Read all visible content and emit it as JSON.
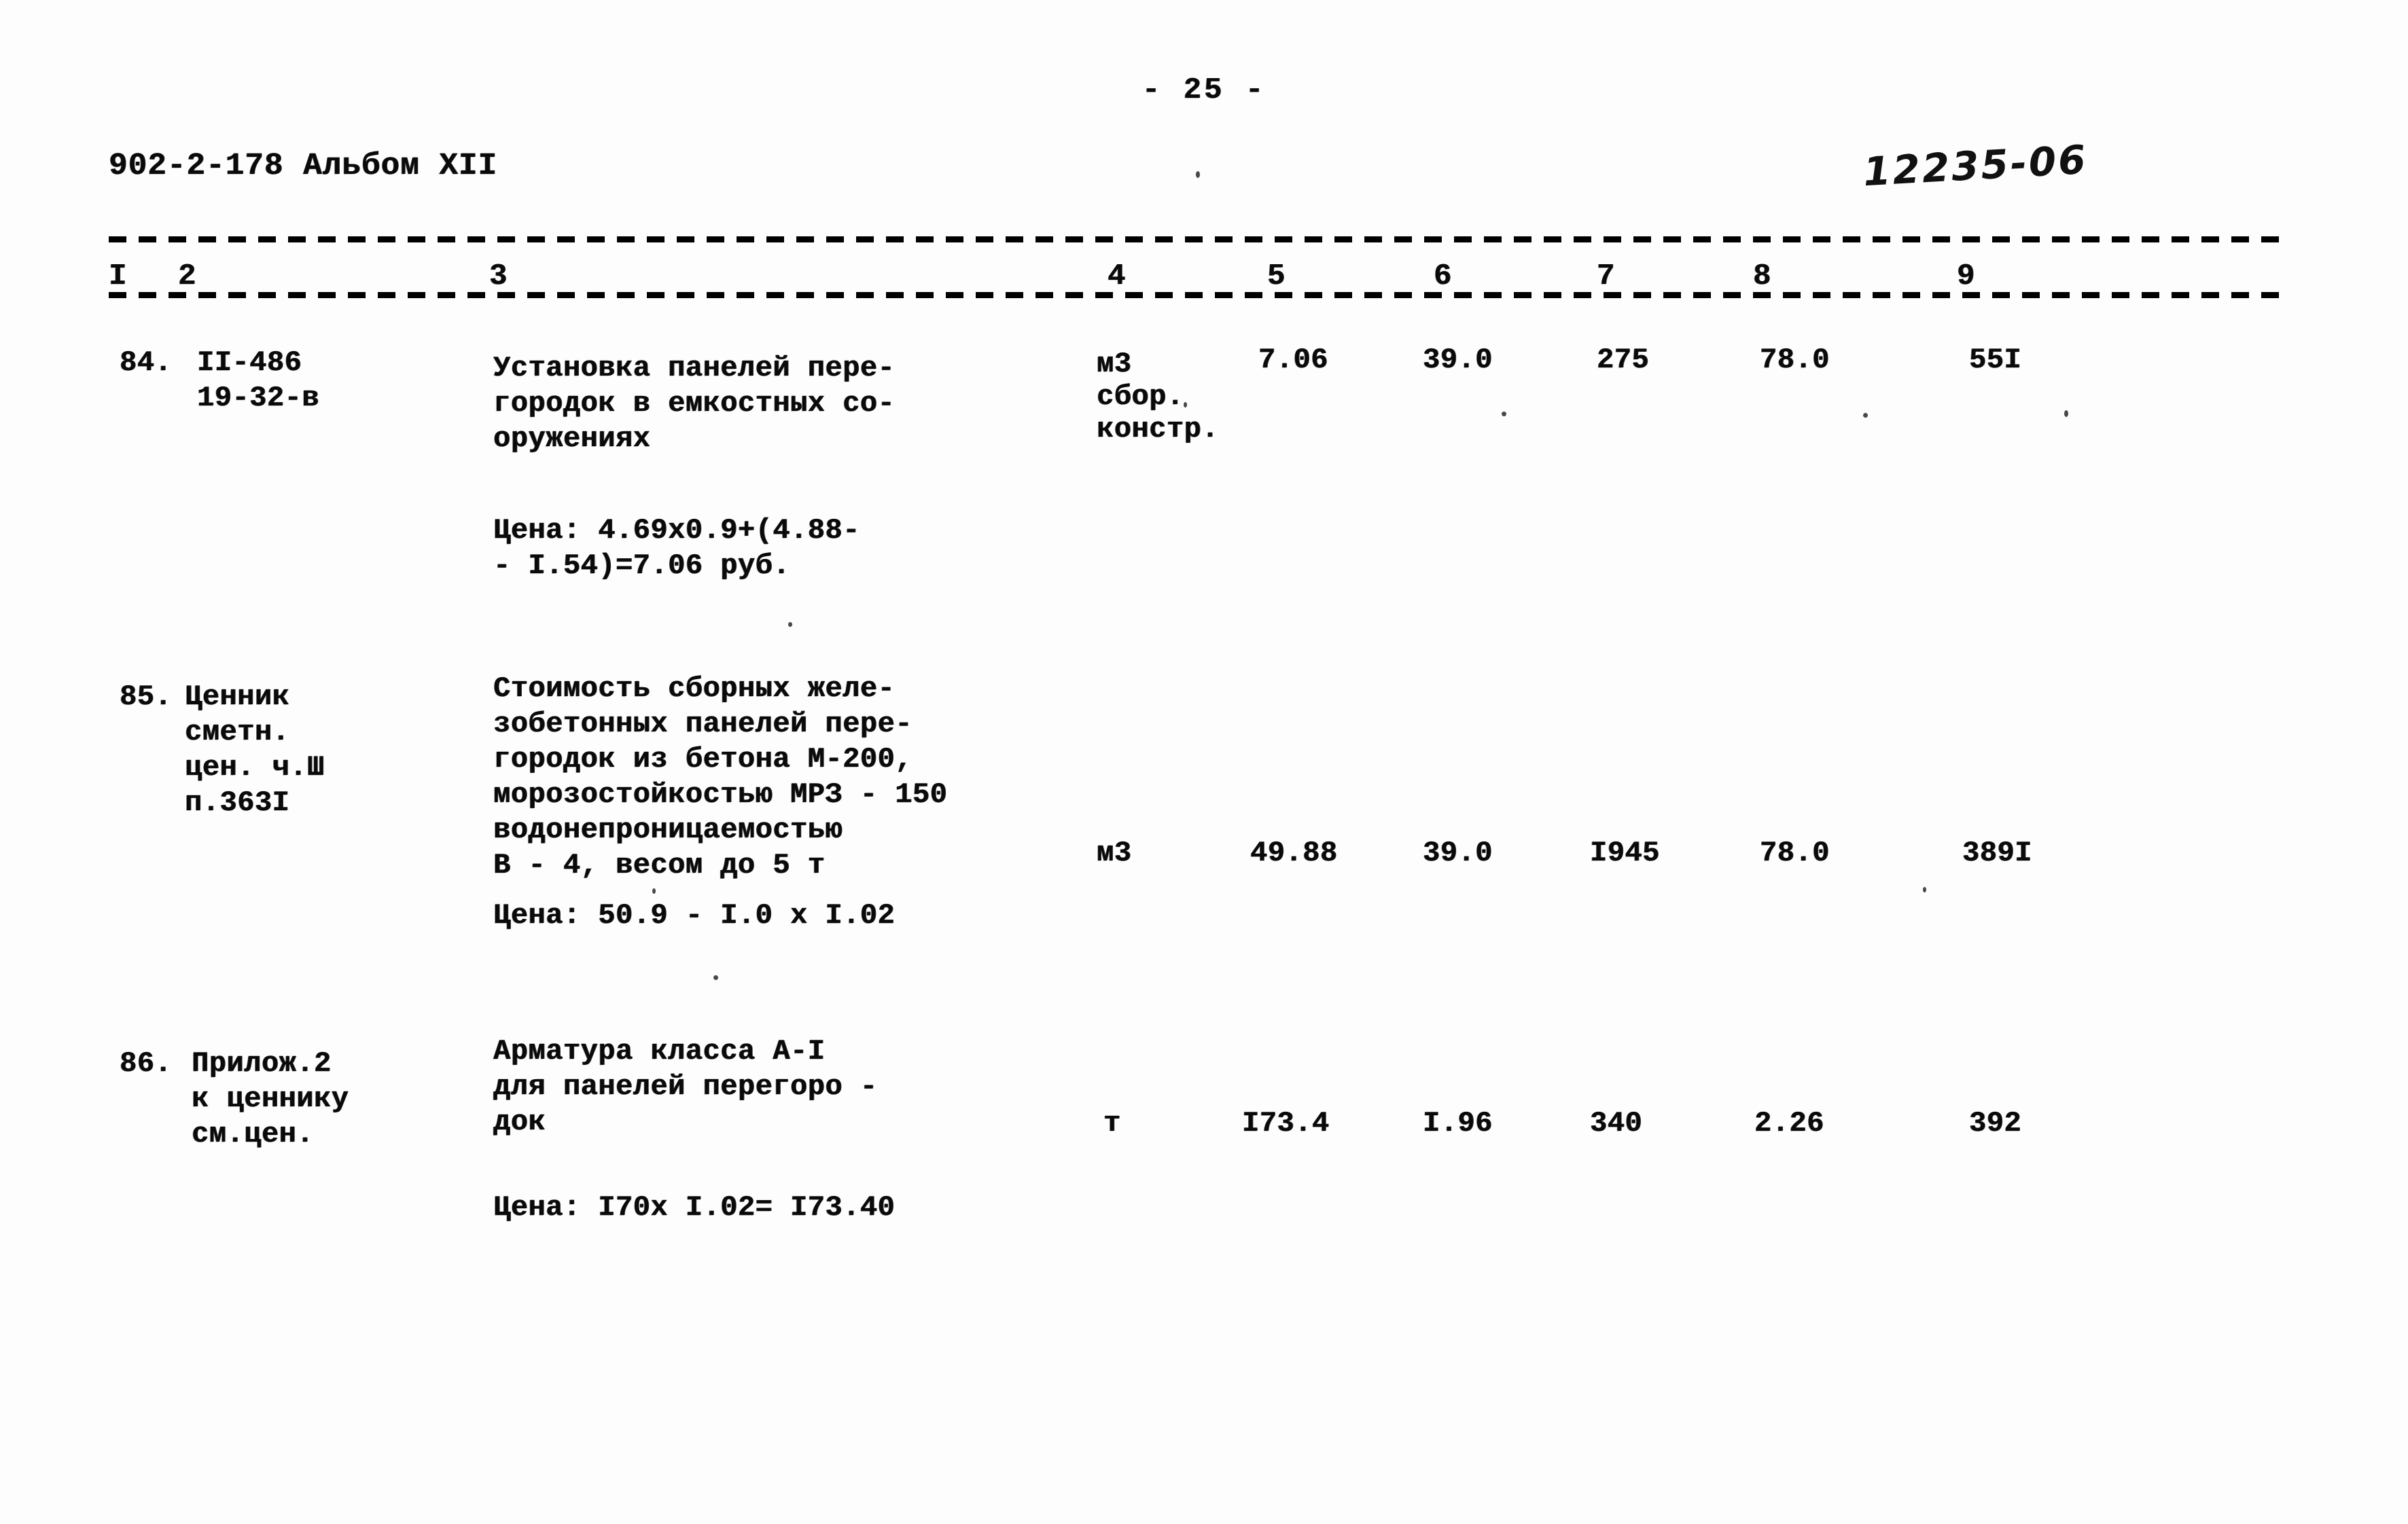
{
  "page": {
    "page_number_label": "- 25 -",
    "doc_code": "902-2-178 Альбом XII",
    "archive_number": "12235-06"
  },
  "table": {
    "column_headers": [
      "I",
      "2",
      "3",
      "4",
      "5",
      "6",
      "7",
      "8",
      "9"
    ],
    "rows": [
      {
        "id": "row-84",
        "col1": "84.",
        "col2": "II-486\n19-32-в",
        "col3": "Установка панелей пере-\nгородок в емкостных со-\nоружениях",
        "note": "Цена: 4.69х0.9+(4.88-\n- I.54)=7.06 руб.",
        "col4": "м3\nсбор.\nконстр.",
        "col5": "7.06",
        "col6": "39.0",
        "col7": "275",
        "col8": "78.0",
        "col9": "55I"
      },
      {
        "id": "row-85",
        "col1": "85.",
        "col2": "Ценник\nсметн.\nцен. ч.Ш\nп.363I",
        "col3": "Стоимость сборных желе-\nзобетонных панелей пере-\nгородок из бетона М-200,\nморозостойкостью МРЗ - 150\nводонепроницаемостью\nВ - 4, весом до 5 т",
        "note": "Цена: 50.9 - I.0 х I.02",
        "col4": "м3",
        "col5": "49.88",
        "col6": "39.0",
        "col7": "I945",
        "col8": "78.0",
        "col9": "389I"
      },
      {
        "id": "row-86",
        "col1": "86.",
        "col2": "Прилож.2\nк ценнику\nсм.цен.",
        "col3": "Арматура класса А-I\nдля панелей перегоро -\nдок",
        "note": "Цена: I70х I.02= I73.40",
        "col4": "т",
        "col5": "I73.4",
        "col6": "I.96",
        "col7": "340",
        "col8": "2.26",
        "col9": "392"
      }
    ]
  }
}
